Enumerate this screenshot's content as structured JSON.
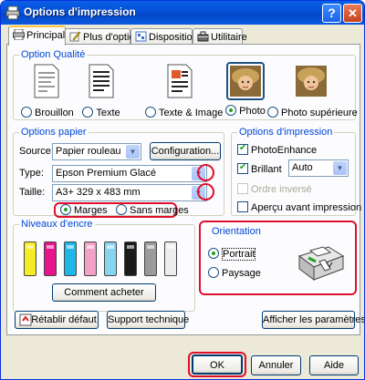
{
  "window": {
    "title": "Options d'impression",
    "help_glyph": "?",
    "close_glyph": "✕"
  },
  "tabs": [
    {
      "label": "Principal",
      "icon": "printer-icon"
    },
    {
      "label": "Plus d'options",
      "icon": "pencil-icon"
    },
    {
      "label": "Disposition",
      "icon": "layout-icon"
    },
    {
      "label": "Utilitaire",
      "icon": "toolbox-icon"
    }
  ],
  "quality": {
    "legend": "Option Qualité",
    "options": [
      "Brouillon",
      "Texte",
      "Texte & Image",
      "Photo",
      "Photo supérieure"
    ],
    "selected": "Photo"
  },
  "paper": {
    "legend": "Options papier",
    "source_label": "Source:",
    "source_value": "Papier rouleau",
    "config_button": "Configuration...",
    "type_label": "Type:",
    "type_value": "Epson Premium Glacé",
    "size_label": "Taille:",
    "size_value": "A3+ 329 x 483 mm",
    "margins_label": "Marges",
    "no_margins_label": "Sans marges",
    "margin_selected": "Marges"
  },
  "print_options": {
    "legend": "Options d'impression",
    "photoenhance_label": "PhotoEnhance",
    "photoenhance_checked": true,
    "brilliant_label": "Brillant",
    "brilliant_checked": true,
    "brilliant_value": "Auto",
    "reverse_label": "Ordre inversé",
    "reverse_checked": false,
    "preview_label": "Aperçu avant impression",
    "preview_checked": false
  },
  "ink": {
    "legend": "Niveaux d'encre",
    "cartridges": [
      "#f5ec24",
      "#e6138c",
      "#1fb6e8",
      "#f2a1c8",
      "#86d4f0",
      "#1a1a1a",
      "#9a9a9a",
      "#ededed"
    ],
    "buy_button": "Comment acheter"
  },
  "orientation": {
    "legend": "Orientation",
    "portrait_label": "Portrait",
    "landscape_label": "Paysage",
    "selected": "Portrait"
  },
  "actions": {
    "restore_button": "Rétablir défaut",
    "support_button": "Support technique",
    "show_settings_button": "Afficher les paramètres"
  },
  "footer": {
    "ok_button": "OK",
    "cancel_button": "Annuler",
    "help_button": "Aide"
  }
}
